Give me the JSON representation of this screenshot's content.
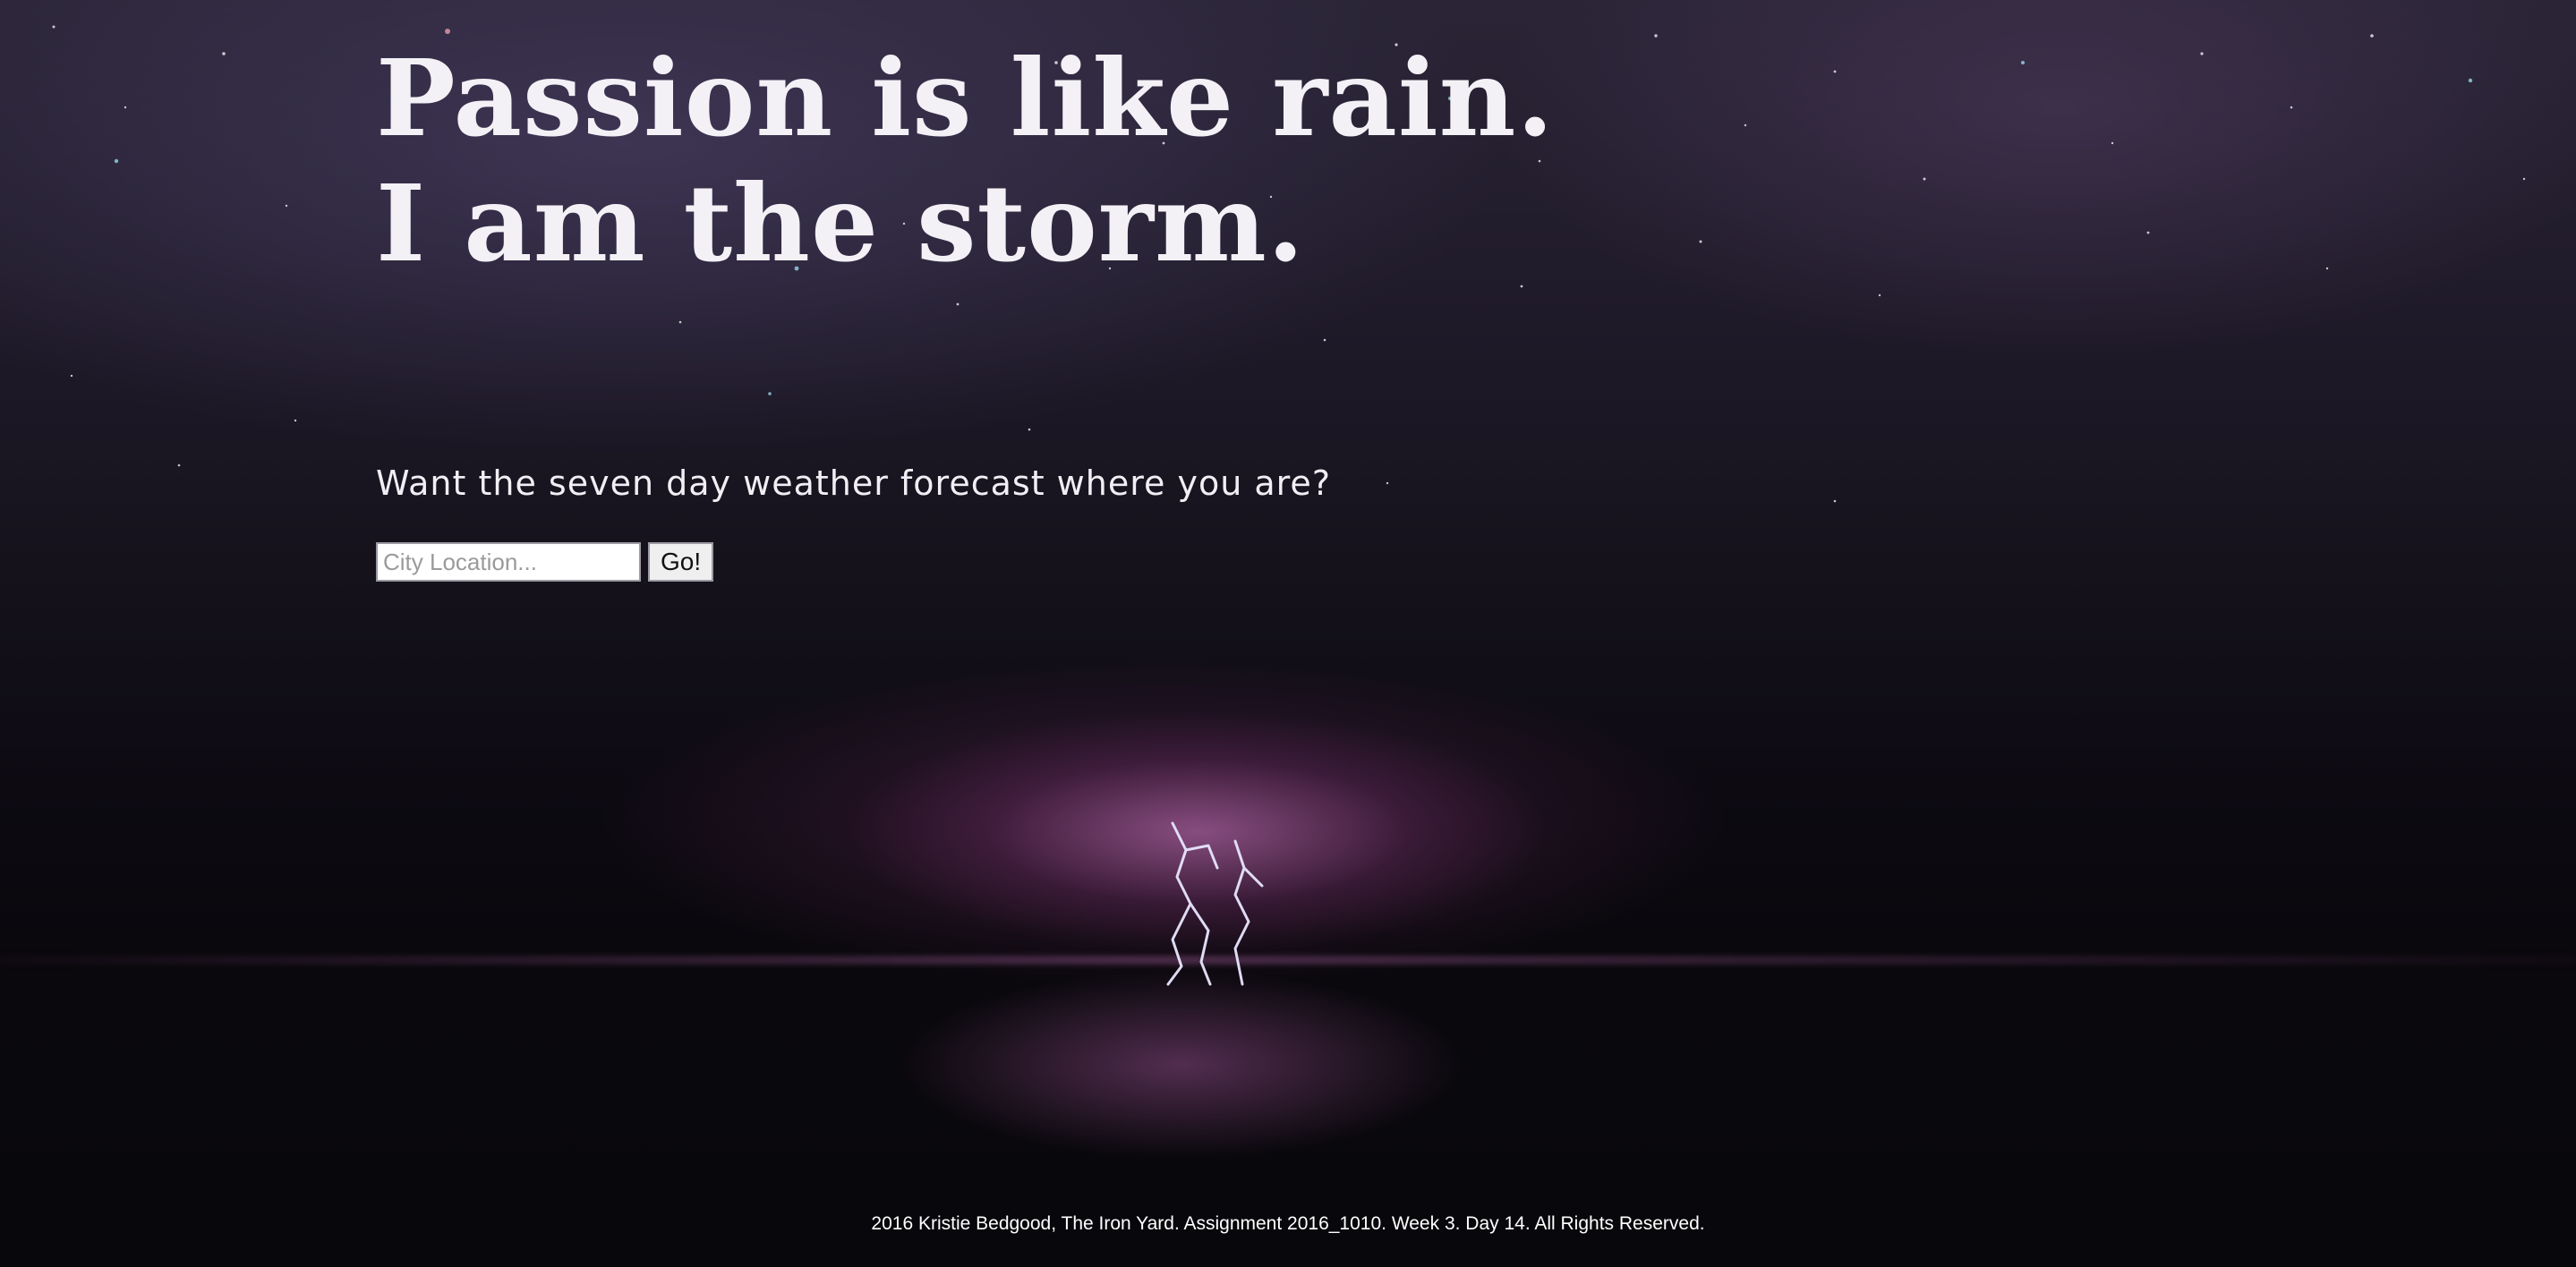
{
  "hero": {
    "headline_line1": "Passion is like rain.",
    "headline_line2": "I am the storm."
  },
  "forecast": {
    "prompt": "Want the seven day weather forecast where you are?",
    "city_placeholder": "City Location...",
    "city_value": "",
    "go_label": "Go!"
  },
  "footer": {
    "text": "2016 Kristie Bedgood, The Iron Yard. Assignment 2016_1010. Week 3. Day 14. All Rights Reserved."
  },
  "colors": {
    "text": "#f3f1f6",
    "sky_dark": "#07060b",
    "lightning_glow": "#c878be"
  }
}
